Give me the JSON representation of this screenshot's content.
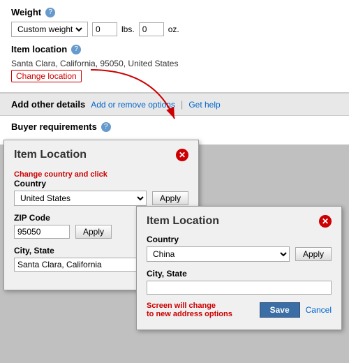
{
  "main": {
    "weight_label": "Weight",
    "weight_option": "Custom weight",
    "lbs_unit": "lbs.",
    "oz_unit": "oz.",
    "lbs_value": "0",
    "oz_value": "0",
    "item_location_label": "Item location",
    "location_address": "Santa Clara, California, 95050, United States",
    "change_location_btn": "Change location",
    "add_other_details_label": "Add other details",
    "add_remove_link": "Add or remove options",
    "pipe": "|",
    "get_help_link": "Get help",
    "buyer_req_label": "Buyer requirements"
  },
  "dialog1": {
    "title": "Item Location",
    "country_label": "Country",
    "country_value": "United States",
    "apply_btn": "Apply",
    "zip_label": "ZIP Code",
    "zip_value": "95050",
    "zip_apply_btn": "Apply",
    "city_state_label": "City, State",
    "city_state_value": "Santa Clara, California",
    "change_hint": "Change country and click"
  },
  "dialog2": {
    "title": "Item Location",
    "country_label": "Country",
    "country_value": "China",
    "apply_btn": "Apply",
    "city_state_label": "City, State",
    "city_state_value": "",
    "screen_hint_line1": "Screen will change",
    "screen_hint_line2": "to new address options",
    "save_btn": "Save",
    "cancel_btn": "Cancel"
  }
}
